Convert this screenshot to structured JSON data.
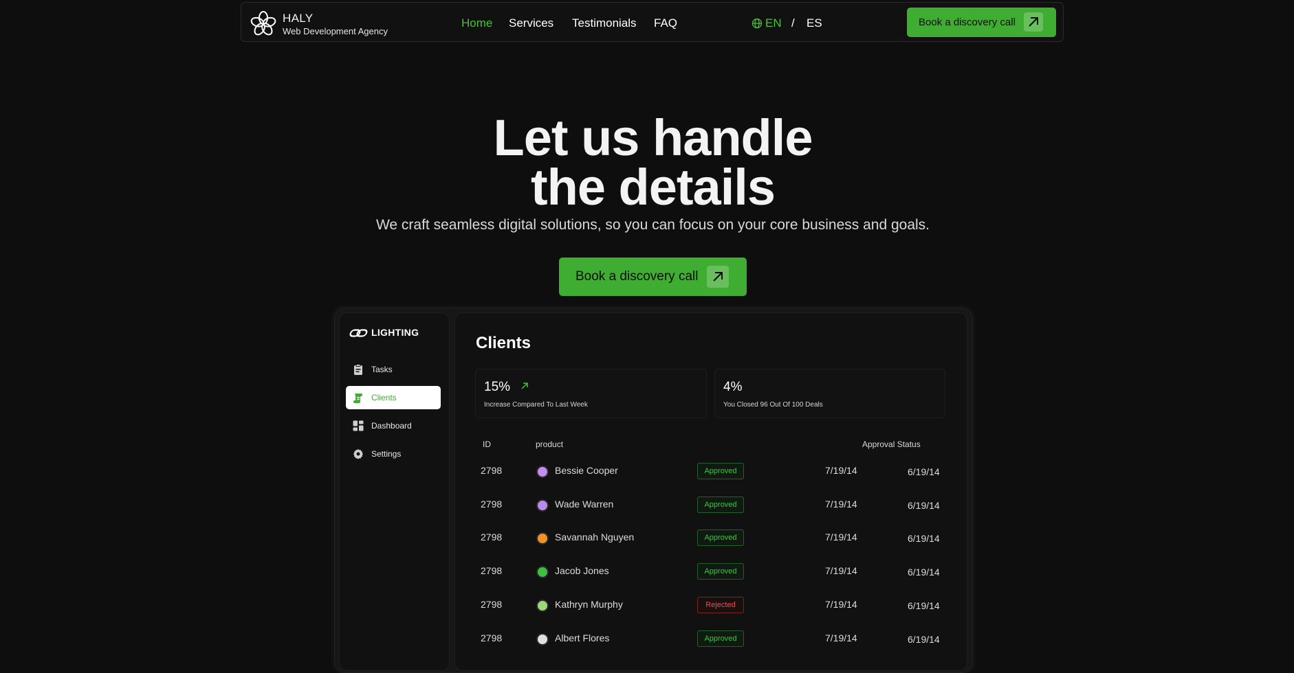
{
  "brand": {
    "name": "HALY",
    "tagline": "Web Development Agency",
    "logo_icon": "flower-logo-icon"
  },
  "nav": {
    "links": [
      {
        "label": "Home",
        "active": true
      },
      {
        "label": "Services",
        "active": false
      },
      {
        "label": "Testimonials",
        "active": false
      },
      {
        "label": "FAQ",
        "active": false
      }
    ],
    "languages": {
      "icon": "globe-icon",
      "current": "EN",
      "separator": "/",
      "other": "ES"
    },
    "cta_label": "Book a discovery call",
    "cta_icon": "arrow-up-right-icon"
  },
  "hero": {
    "title_line1": "Let us handle",
    "title_line2": "the details",
    "subtitle": "We craft seamless digital solutions, so you can focus on your core business and goals.",
    "cta_label": "Book a discovery call"
  },
  "dashboard": {
    "brand": "LIGHTING",
    "sidebar": [
      {
        "label": "Tasks",
        "icon": "clipboard-icon",
        "active": false
      },
      {
        "label": "Clients",
        "icon": "scroll-icon",
        "active": true
      },
      {
        "label": "Dashboard",
        "icon": "grid-icon",
        "active": false
      },
      {
        "label": "Settings",
        "icon": "gear-icon",
        "active": false
      }
    ],
    "title": "Clients",
    "stats": [
      {
        "value": "15%",
        "caption": "Increase Compared To Last Week",
        "icon": "arrow-up-right-icon"
      },
      {
        "value": "4%",
        "caption": "You Closed 96 Out Of 100 Deals"
      }
    ],
    "table": {
      "headers": {
        "id": "ID",
        "product": "product",
        "approval": "Approval Status"
      },
      "rows": [
        {
          "id": "2798",
          "name": "Bessie Cooper",
          "status": "Approved",
          "date1": "7/19/14",
          "date2": "6/19/14"
        },
        {
          "id": "2798",
          "name": "Wade Warren",
          "status": "Approved",
          "date1": "7/19/14",
          "date2": "6/19/14"
        },
        {
          "id": "2798",
          "name": "Savannah Nguyen",
          "status": "Approved",
          "date1": "7/19/14",
          "date2": "6/19/14"
        },
        {
          "id": "2798",
          "name": "Jacob Jones",
          "status": "Approved",
          "date1": "7/19/14",
          "date2": "6/19/14"
        },
        {
          "id": "2798",
          "name": "Kathryn Murphy",
          "status": "Rejected",
          "date1": "7/19/14",
          "date2": "6/19/14"
        },
        {
          "id": "2798",
          "name": "Albert Flores",
          "status": "Approved",
          "date1": "7/19/14",
          "date2": "6/19/14"
        }
      ]
    }
  },
  "colors": {
    "accent": "#3fad31",
    "active_link": "#4cc13c",
    "background": "#0e0e0e",
    "approved": "#43c245",
    "rejected": "#e2564f"
  }
}
